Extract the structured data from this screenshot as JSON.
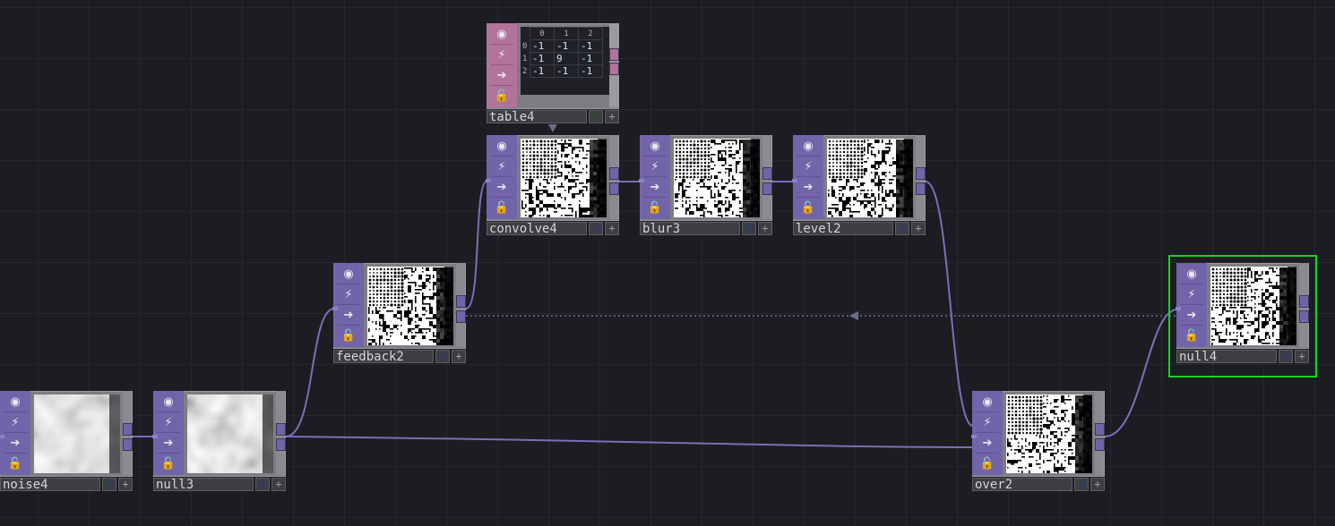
{
  "nodes": [
    {
      "id": "noise4",
      "label": "noise4",
      "kind": "top",
      "texture": "noise"
    },
    {
      "id": "null3",
      "label": "null3",
      "kind": "top",
      "texture": "noise"
    },
    {
      "id": "feedback2",
      "label": "feedback2",
      "kind": "top",
      "texture": "pattern"
    },
    {
      "id": "convolve4",
      "label": "convolve4",
      "kind": "top",
      "texture": "pattern"
    },
    {
      "id": "blur3",
      "label": "blur3",
      "kind": "top",
      "texture": "pattern"
    },
    {
      "id": "level2",
      "label": "level2",
      "kind": "top",
      "texture": "pattern"
    },
    {
      "id": "over2",
      "label": "over2",
      "kind": "top",
      "texture": "pattern"
    },
    {
      "id": "null4",
      "label": "null4",
      "kind": "top",
      "texture": "pattern",
      "selected": true
    },
    {
      "id": "table4",
      "label": "table4",
      "kind": "dat"
    }
  ],
  "table4": {
    "col_headers": [
      "0",
      "1",
      "2"
    ],
    "rows": [
      {
        "index": "0",
        "cells": [
          "-1",
          "-1",
          "-1"
        ]
      },
      {
        "index": "1",
        "cells": [
          "-1",
          "9",
          "-1"
        ]
      },
      {
        "index": "2",
        "cells": [
          "-1",
          "-1",
          "-1"
        ]
      }
    ]
  },
  "colors": {
    "background": "#1c1d22",
    "top_strip": "#7264a8",
    "dat_strip": "#b2739a",
    "wire": "#8276c0",
    "selection": "#16d41c"
  },
  "icons": [
    "viewer-icon",
    "bypass-icon",
    "display-icon",
    "lock-icon",
    "add-icon"
  ]
}
